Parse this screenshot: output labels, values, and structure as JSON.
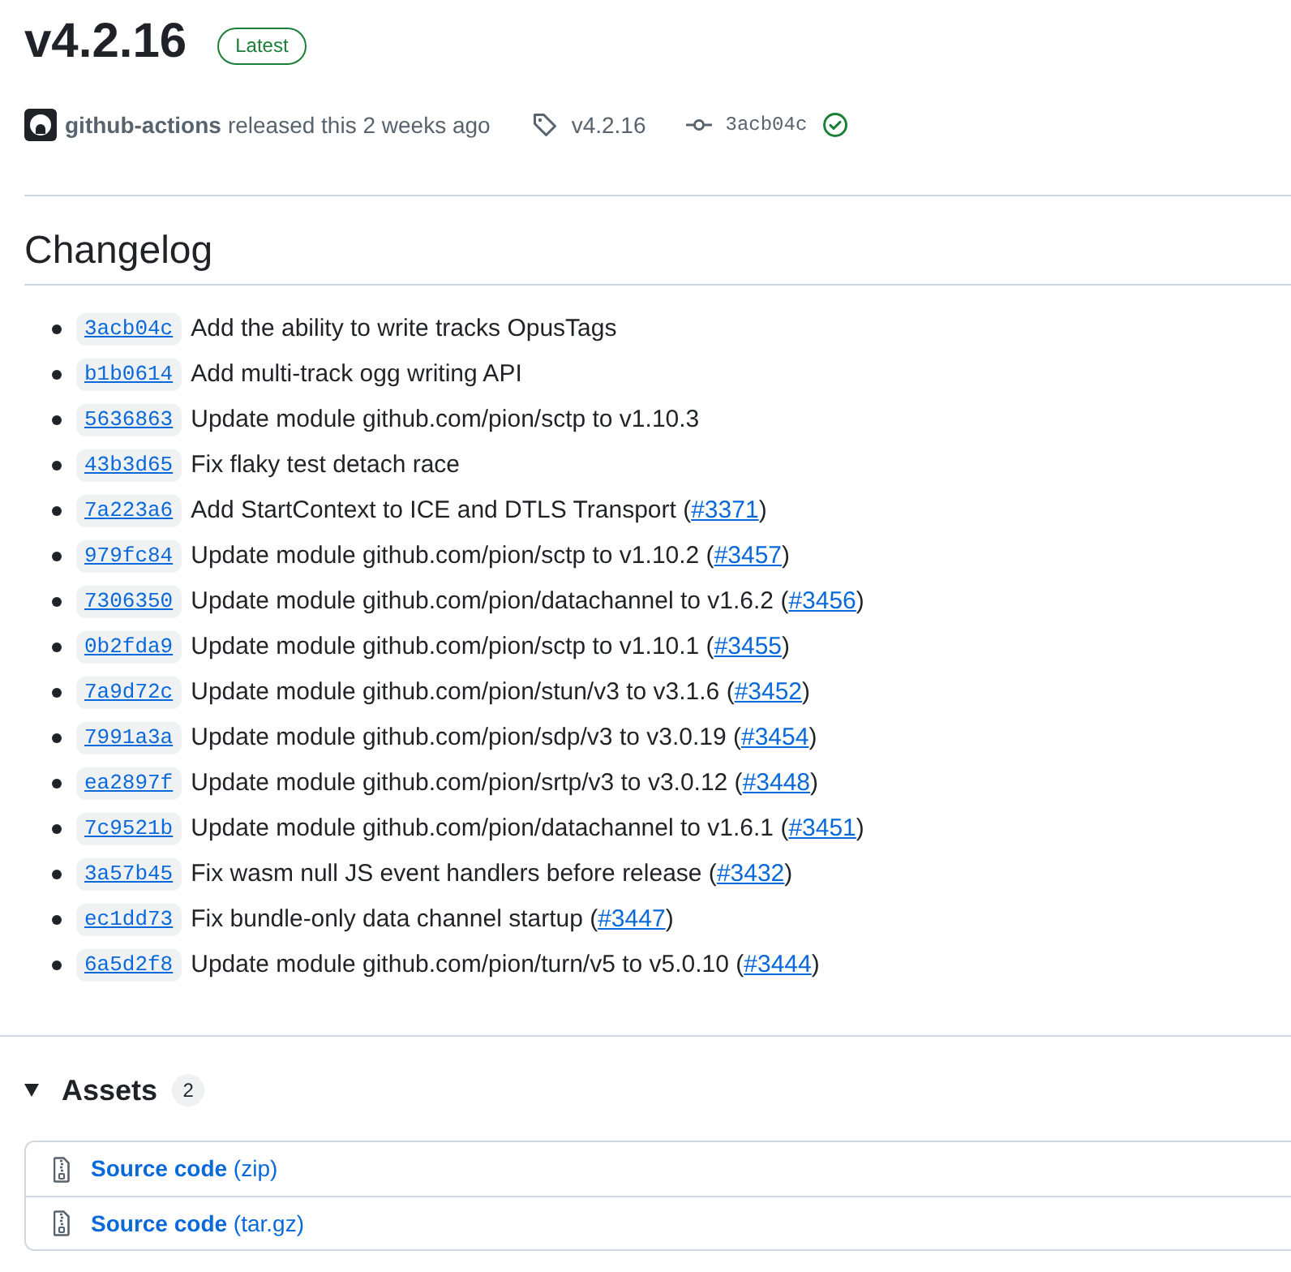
{
  "release": {
    "title": "v4.2.16",
    "badge": "Latest",
    "author": "github-actions",
    "released": "released this 2 weeks ago",
    "tag": "v4.2.16",
    "commit": "3acb04c",
    "verified": true
  },
  "changelog": {
    "heading": "Changelog",
    "items": [
      {
        "sha": "3acb04c",
        "message": "Add the ability to write tracks OpusTags"
      },
      {
        "sha": "b1b0614",
        "message": "Add multi-track ogg writing API"
      },
      {
        "sha": "5636863",
        "message": "Update module github.com/pion/sctp to v1.10.3"
      },
      {
        "sha": "43b3d65",
        "message": "Fix flaky test detach race"
      },
      {
        "sha": "7a223a6",
        "message": "Add StartContext to ICE and DTLS Transport (",
        "pr": "#3371",
        "message_end": ")"
      },
      {
        "sha": "979fc84",
        "message": "Update module github.com/pion/sctp to v1.10.2 (",
        "pr": "#3457",
        "message_end": ")"
      },
      {
        "sha": "7306350",
        "message": "Update module github.com/pion/datachannel to v1.6.2 (",
        "pr": "#3456",
        "message_end": ")"
      },
      {
        "sha": "0b2fda9",
        "message": "Update module github.com/pion/sctp to v1.10.1 (",
        "pr": "#3455",
        "message_end": ")"
      },
      {
        "sha": "7a9d72c",
        "message": "Update module github.com/pion/stun/v3 to v3.1.6 (",
        "pr": "#3452",
        "message_end": ")"
      },
      {
        "sha": "7991a3a",
        "message": "Update module github.com/pion/sdp/v3 to v3.0.19 (",
        "pr": "#3454",
        "message_end": ")"
      },
      {
        "sha": "ea2897f",
        "message": "Update module github.com/pion/srtp/v3 to v3.0.12 (",
        "pr": "#3448",
        "message_end": ")"
      },
      {
        "sha": "7c9521b",
        "message": "Update module github.com/pion/datachannel to v1.6.1 (",
        "pr": "#3451",
        "message_end": ")"
      },
      {
        "sha": "3a57b45",
        "message": "Fix wasm null JS event handlers before release (",
        "pr": "#3432",
        "message_end": ")"
      },
      {
        "sha": "ec1dd73",
        "message": "Fix bundle-only data channel startup (",
        "pr": "#3447",
        "message_end": ")"
      },
      {
        "sha": "6a5d2f8",
        "message": "Update module github.com/pion/turn/v5 to v5.0.10 (",
        "pr": "#3444",
        "message_end": ")"
      }
    ]
  },
  "assets": {
    "heading": "Assets",
    "count": "2",
    "expanded": true,
    "items": [
      {
        "label": "**Source code** (zip)"
      },
      {
        "label": "**Source code** (tar.gz)"
      }
    ]
  }
}
